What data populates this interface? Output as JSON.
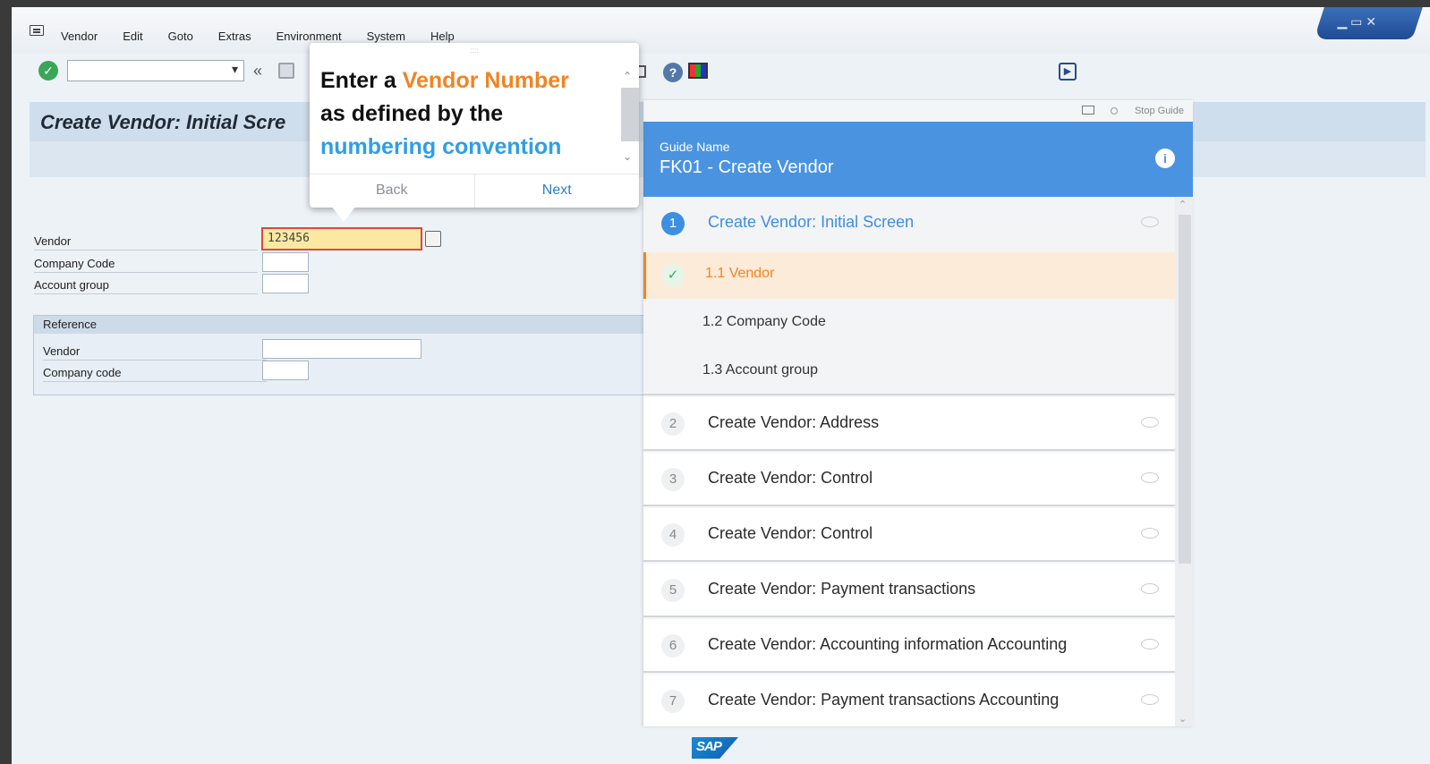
{
  "menu": [
    "Vendor",
    "Edit",
    "Goto",
    "Extras",
    "Environment",
    "System",
    "Help"
  ],
  "window_controls": "▁ ▭ ✕",
  "toolbar": {
    "back_double": "«",
    "play_label": "▶"
  },
  "screen": {
    "title": "Create Vendor:  Initial Scre"
  },
  "form": {
    "vendor_label": "Vendor",
    "vendor_value": "123456",
    "company_code_label": "Company Code",
    "account_group_label": "Account group",
    "reference_title": "Reference",
    "ref_vendor_label": "Vendor",
    "ref_company_code_label": "Company code"
  },
  "callout": {
    "line1_pre": "Enter a ",
    "line1_hl": "Vendor Number",
    "line2": "as defined by the",
    "line3_hl": "numbering convention",
    "back": "Back",
    "next": "Next",
    "grip": "::::"
  },
  "guide": {
    "stop": "Stop Guide",
    "label": "Guide Name",
    "name": "FK01 - Create Vendor",
    "info": "i",
    "steps": [
      {
        "num": "1",
        "text": "Create Vendor:  Initial Screen"
      },
      {
        "num": "2",
        "text": "Create Vendor: Address"
      },
      {
        "num": "3",
        "text": "Create Vendor: Control"
      },
      {
        "num": "4",
        "text": "Create Vendor: Control"
      },
      {
        "num": "5",
        "text": "Create Vendor: Payment transactions"
      },
      {
        "num": "6",
        "text": "Create Vendor: Accounting information Accounting"
      },
      {
        "num": "7",
        "text": "Create Vendor: Payment transactions Accounting"
      }
    ],
    "substeps": [
      {
        "text": "1.1  Vendor"
      },
      {
        "text": "1.2  Company Code"
      },
      {
        "text": "1.3  Account group"
      }
    ]
  },
  "footer": {
    "logo": "SAP"
  },
  "colors": {
    "accent_blue": "#4a93e0",
    "highlight_orange": "#f28322"
  }
}
